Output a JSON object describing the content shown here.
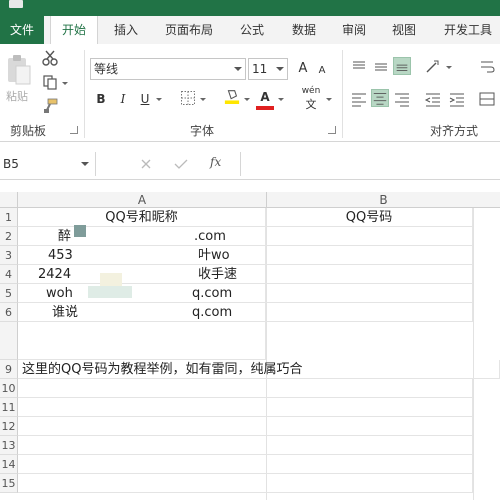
{
  "tabs": [
    {
      "label": "文件"
    },
    {
      "label": "开始"
    },
    {
      "label": "插入"
    },
    {
      "label": "页面布局"
    },
    {
      "label": "公式"
    },
    {
      "label": "数据"
    },
    {
      "label": "审阅"
    },
    {
      "label": "视图"
    },
    {
      "label": "开发工具"
    }
  ],
  "ribbon": {
    "clipboard": {
      "group_label": "剪贴板",
      "paste_label": "粘贴"
    },
    "font": {
      "group_label": "字体",
      "font_name": "等线",
      "font_size": "11",
      "grow_label": "A",
      "shrink_label": "A",
      "bold": "B",
      "italic": "I",
      "underline": "U",
      "font_color_label": "A",
      "phonetic_label": "wén"
    },
    "alignment": {
      "group_label": "对齐方式"
    }
  },
  "formula_bar": {
    "name_box": "B5",
    "fx_label": "fx",
    "value": ""
  },
  "columns": [
    {
      "label": "A"
    },
    {
      "label": "B"
    }
  ],
  "rows": [
    {
      "num": "1",
      "a": "QQ号和昵称",
      "b": "QQ号码"
    },
    {
      "num": "2",
      "a_left": "醉",
      "a_right": ".com"
    },
    {
      "num": "3",
      "a_left": "453",
      "a_right": "叶wo"
    },
    {
      "num": "4",
      "a_left": "2424",
      "a_right": "收手速"
    },
    {
      "num": "5",
      "a_left": "woh",
      "a_right": "q.com"
    },
    {
      "num": "6",
      "a_left": "谁说",
      "a_right": "q.com"
    },
    {
      "num": "9",
      "a": "这里的QQ号码为教程举例，如有雷同，纯属巧合"
    },
    {
      "num": "10"
    },
    {
      "num": "11"
    },
    {
      "num": "12"
    },
    {
      "num": "13"
    },
    {
      "num": "14"
    },
    {
      "num": "15"
    }
  ],
  "colors": {
    "accent": "#217346",
    "selected_align": "#b8d7c4",
    "font_color_bar": "#e02020",
    "highlight_bar": "#ffe600"
  }
}
